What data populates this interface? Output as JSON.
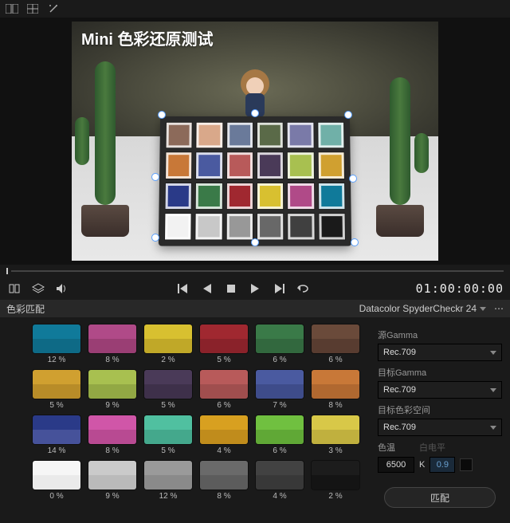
{
  "overlay_title": "Mini 色彩还原测试",
  "timecode": "01:00:00:00",
  "panel": {
    "title": "色彩匹配",
    "preset": "Datacolor SpyderCheckr 24"
  },
  "checker_patches": [
    "#8c6a5a",
    "#d9a88a",
    "#6a7a9a",
    "#5a6a48",
    "#7a7aa8",
    "#70b0a8",
    "#c87838",
    "#4a5aa0",
    "#b85a5a",
    "#4a3a58",
    "#a8c050",
    "#d0a030",
    "#2a3a88",
    "#3a7a48",
    "#a02830",
    "#d8c030",
    "#b04a88",
    "#107a9a",
    "#f2f2f2",
    "#c8c8c8",
    "#989898",
    "#686868",
    "#404040",
    "#1a1a1a"
  ],
  "swatches": [
    {
      "top": "#107a9a",
      "bot": "#0e6a86",
      "pct": "12 %"
    },
    {
      "top": "#b04a88",
      "bot": "#9a3e74",
      "pct": "8 %"
    },
    {
      "top": "#d8c030",
      "bot": "#c0a828",
      "pct": "2 %"
    },
    {
      "top": "#a02830",
      "bot": "#8a222a",
      "pct": "5 %"
    },
    {
      "top": "#3a7a48",
      "bot": "#32683e",
      "pct": "6 %"
    },
    {
      "top": "#6a4a3a",
      "bot": "#583c30",
      "pct": "6 %"
    },
    {
      "top": "#d0a030",
      "bot": "#b88c28",
      "pct": "5 %"
    },
    {
      "top": "#a8c050",
      "bot": "#92a844",
      "pct": "9 %"
    },
    {
      "top": "#4a3a58",
      "bot": "#3e304a",
      "pct": "5 %"
    },
    {
      "top": "#b85a5a",
      "bot": "#a04e4e",
      "pct": "6 %"
    },
    {
      "top": "#4a5aa0",
      "bot": "#3e4c8a",
      "pct": "7 %"
    },
    {
      "top": "#c87838",
      "bot": "#b06830",
      "pct": "8 %"
    },
    {
      "top": "#2a3a88",
      "bot": "#46529a",
      "pct": "14 %"
    },
    {
      "top": "#d056a8",
      "bot": "#b84a92",
      "pct": "8 %"
    },
    {
      "top": "#50c0a0",
      "bot": "#44a88c",
      "pct": "5 %"
    },
    {
      "top": "#d8a020",
      "bot": "#c08c1c",
      "pct": "4 %"
    },
    {
      "top": "#70c040",
      "bot": "#60a836",
      "pct": "6 %"
    },
    {
      "top": "#d8c848",
      "bot": "#c0b03e",
      "pct": "3 %"
    },
    {
      "top": "#f6f6f6",
      "bot": "#eaeaea",
      "pct": "0 %"
    },
    {
      "top": "#cacaca",
      "bot": "#bababa",
      "pct": "9 %"
    },
    {
      "top": "#9a9a9a",
      "bot": "#8a8a8a",
      "pct": "12 %"
    },
    {
      "top": "#6a6a6a",
      "bot": "#5c5c5c",
      "pct": "8 %"
    },
    {
      "top": "#424242",
      "bot": "#383838",
      "pct": "4 %"
    },
    {
      "top": "#1c1c1c",
      "bot": "#141414",
      "pct": "2 %"
    }
  ],
  "side": {
    "src_gamma_label": "源Gamma",
    "src_gamma": "Rec.709",
    "dst_gamma_label": "目标Gamma",
    "dst_gamma": "Rec.709",
    "dst_cs_label": "目标色彩空间",
    "dst_cs": "Rec.709",
    "temp_label": "色温",
    "tint_label": "白电平",
    "temp_value": "6500",
    "temp_unit": "K",
    "tint_value": "0.9",
    "match_button": "匹配"
  }
}
